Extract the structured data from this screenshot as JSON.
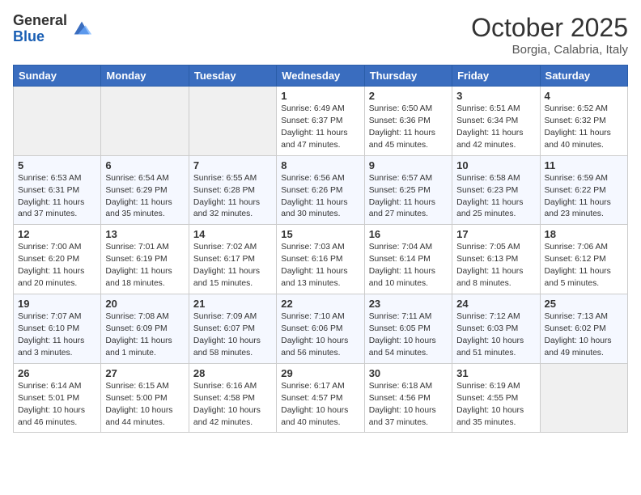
{
  "header": {
    "logo_general": "General",
    "logo_blue": "Blue",
    "title": "October 2025",
    "location": "Borgia, Calabria, Italy"
  },
  "days_of_week": [
    "Sunday",
    "Monday",
    "Tuesday",
    "Wednesday",
    "Thursday",
    "Friday",
    "Saturday"
  ],
  "weeks": [
    [
      {
        "day": "",
        "info": ""
      },
      {
        "day": "",
        "info": ""
      },
      {
        "day": "",
        "info": ""
      },
      {
        "day": "1",
        "info": "Sunrise: 6:49 AM\nSunset: 6:37 PM\nDaylight: 11 hours\nand 47 minutes."
      },
      {
        "day": "2",
        "info": "Sunrise: 6:50 AM\nSunset: 6:36 PM\nDaylight: 11 hours\nand 45 minutes."
      },
      {
        "day": "3",
        "info": "Sunrise: 6:51 AM\nSunset: 6:34 PM\nDaylight: 11 hours\nand 42 minutes."
      },
      {
        "day": "4",
        "info": "Sunrise: 6:52 AM\nSunset: 6:32 PM\nDaylight: 11 hours\nand 40 minutes."
      }
    ],
    [
      {
        "day": "5",
        "info": "Sunrise: 6:53 AM\nSunset: 6:31 PM\nDaylight: 11 hours\nand 37 minutes."
      },
      {
        "day": "6",
        "info": "Sunrise: 6:54 AM\nSunset: 6:29 PM\nDaylight: 11 hours\nand 35 minutes."
      },
      {
        "day": "7",
        "info": "Sunrise: 6:55 AM\nSunset: 6:28 PM\nDaylight: 11 hours\nand 32 minutes."
      },
      {
        "day": "8",
        "info": "Sunrise: 6:56 AM\nSunset: 6:26 PM\nDaylight: 11 hours\nand 30 minutes."
      },
      {
        "day": "9",
        "info": "Sunrise: 6:57 AM\nSunset: 6:25 PM\nDaylight: 11 hours\nand 27 minutes."
      },
      {
        "day": "10",
        "info": "Sunrise: 6:58 AM\nSunset: 6:23 PM\nDaylight: 11 hours\nand 25 minutes."
      },
      {
        "day": "11",
        "info": "Sunrise: 6:59 AM\nSunset: 6:22 PM\nDaylight: 11 hours\nand 23 minutes."
      }
    ],
    [
      {
        "day": "12",
        "info": "Sunrise: 7:00 AM\nSunset: 6:20 PM\nDaylight: 11 hours\nand 20 minutes."
      },
      {
        "day": "13",
        "info": "Sunrise: 7:01 AM\nSunset: 6:19 PM\nDaylight: 11 hours\nand 18 minutes."
      },
      {
        "day": "14",
        "info": "Sunrise: 7:02 AM\nSunset: 6:17 PM\nDaylight: 11 hours\nand 15 minutes."
      },
      {
        "day": "15",
        "info": "Sunrise: 7:03 AM\nSunset: 6:16 PM\nDaylight: 11 hours\nand 13 minutes."
      },
      {
        "day": "16",
        "info": "Sunrise: 7:04 AM\nSunset: 6:14 PM\nDaylight: 11 hours\nand 10 minutes."
      },
      {
        "day": "17",
        "info": "Sunrise: 7:05 AM\nSunset: 6:13 PM\nDaylight: 11 hours\nand 8 minutes."
      },
      {
        "day": "18",
        "info": "Sunrise: 7:06 AM\nSunset: 6:12 PM\nDaylight: 11 hours\nand 5 minutes."
      }
    ],
    [
      {
        "day": "19",
        "info": "Sunrise: 7:07 AM\nSunset: 6:10 PM\nDaylight: 11 hours\nand 3 minutes."
      },
      {
        "day": "20",
        "info": "Sunrise: 7:08 AM\nSunset: 6:09 PM\nDaylight: 11 hours\nand 1 minute."
      },
      {
        "day": "21",
        "info": "Sunrise: 7:09 AM\nSunset: 6:07 PM\nDaylight: 10 hours\nand 58 minutes."
      },
      {
        "day": "22",
        "info": "Sunrise: 7:10 AM\nSunset: 6:06 PM\nDaylight: 10 hours\nand 56 minutes."
      },
      {
        "day": "23",
        "info": "Sunrise: 7:11 AM\nSunset: 6:05 PM\nDaylight: 10 hours\nand 54 minutes."
      },
      {
        "day": "24",
        "info": "Sunrise: 7:12 AM\nSunset: 6:03 PM\nDaylight: 10 hours\nand 51 minutes."
      },
      {
        "day": "25",
        "info": "Sunrise: 7:13 AM\nSunset: 6:02 PM\nDaylight: 10 hours\nand 49 minutes."
      }
    ],
    [
      {
        "day": "26",
        "info": "Sunrise: 6:14 AM\nSunset: 5:01 PM\nDaylight: 10 hours\nand 46 minutes."
      },
      {
        "day": "27",
        "info": "Sunrise: 6:15 AM\nSunset: 5:00 PM\nDaylight: 10 hours\nand 44 minutes."
      },
      {
        "day": "28",
        "info": "Sunrise: 6:16 AM\nSunset: 4:58 PM\nDaylight: 10 hours\nand 42 minutes."
      },
      {
        "day": "29",
        "info": "Sunrise: 6:17 AM\nSunset: 4:57 PM\nDaylight: 10 hours\nand 40 minutes."
      },
      {
        "day": "30",
        "info": "Sunrise: 6:18 AM\nSunset: 4:56 PM\nDaylight: 10 hours\nand 37 minutes."
      },
      {
        "day": "31",
        "info": "Sunrise: 6:19 AM\nSunset: 4:55 PM\nDaylight: 10 hours\nand 35 minutes."
      },
      {
        "day": "",
        "info": ""
      }
    ]
  ]
}
